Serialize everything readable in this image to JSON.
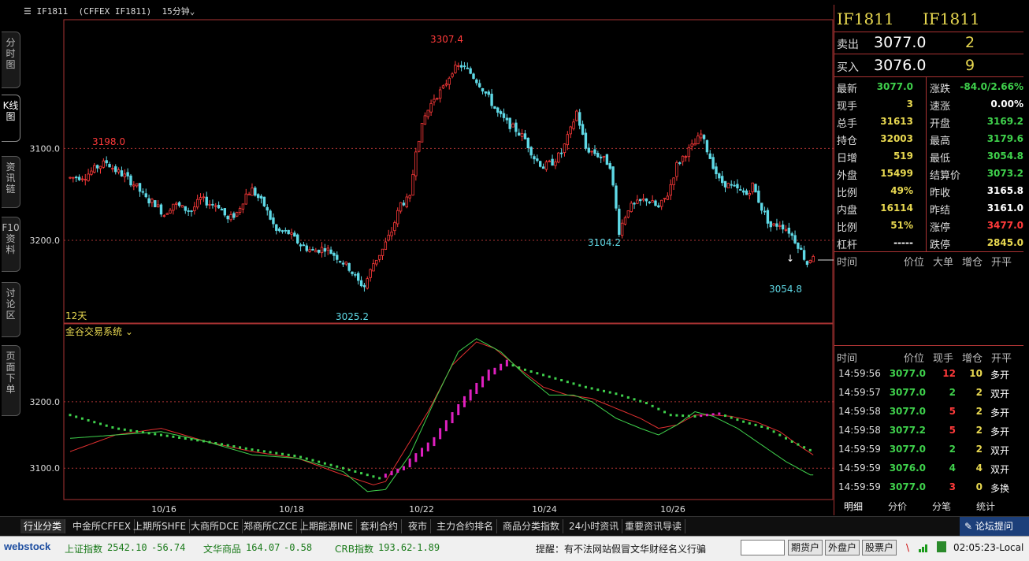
{
  "window": {
    "symbol": "IF1811",
    "exchange_symbol": "(CFFEX IF1811)",
    "period": "15分钟"
  },
  "left_tabs": [
    {
      "label": "分时图",
      "active": false
    },
    {
      "label": "K线图",
      "active": true
    },
    {
      "label": "资讯链",
      "active": false
    },
    {
      "label": "F10资料",
      "active": false
    },
    {
      "label": "讨论区",
      "active": false
    },
    {
      "label": "页面下单",
      "active": false
    }
  ],
  "main_chart": {
    "y_labels": [
      "3200.0",
      "3100.0"
    ],
    "annotations": {
      "high": "3307.4",
      "left_high": "3198.0",
      "low": "3025.2",
      "mid_low": "3104.2",
      "last_low": "3054.8"
    },
    "days_label": "12天"
  },
  "indicator": {
    "name": "金谷交易系统",
    "y_labels": [
      "3200.0",
      "3100.0"
    ]
  },
  "x_dates": [
    "10/16",
    "10/18",
    "10/22",
    "10/24",
    "10/26"
  ],
  "chart_data": {
    "type": "candlestick",
    "ylim": [
      3010,
      3340
    ],
    "y_ticks": [
      3100,
      3200
    ],
    "anchors": [
      [
        0,
        3168
      ],
      [
        5,
        3170
      ],
      [
        9,
        3180
      ],
      [
        12,
        3185
      ],
      [
        15,
        3176
      ],
      [
        18,
        3170
      ],
      [
        22,
        3158
      ],
      [
        25,
        3145
      ],
      [
        28,
        3140
      ],
      [
        31,
        3128
      ],
      [
        34,
        3140
      ],
      [
        37,
        3135
      ],
      [
        40,
        3132
      ],
      [
        43,
        3145
      ],
      [
        46,
        3140
      ],
      [
        49,
        3138
      ],
      [
        52,
        3122
      ],
      [
        55,
        3130
      ],
      [
        58,
        3150
      ],
      [
        60,
        3155
      ],
      [
        64,
        3138
      ],
      [
        68,
        3110
      ],
      [
        72,
        3108
      ],
      [
        76,
        3095
      ],
      [
        80,
        3088
      ],
      [
        84,
        3092
      ],
      [
        88,
        3082
      ],
      [
        92,
        3070
      ],
      [
        95,
        3055
      ],
      [
        97,
        3050
      ],
      [
        100,
        3075
      ],
      [
        103,
        3090
      ],
      [
        106,
        3110
      ],
      [
        109,
        3140
      ],
      [
        112,
        3145
      ],
      [
        114,
        3200
      ],
      [
        117,
        3235
      ],
      [
        120,
        3255
      ],
      [
        123,
        3265
      ],
      [
        126,
        3285
      ],
      [
        129,
        3290
      ],
      [
        132,
        3282
      ],
      [
        135,
        3270
      ],
      [
        138,
        3255
      ],
      [
        141,
        3238
      ],
      [
        144,
        3228
      ],
      [
        147,
        3220
      ],
      [
        150,
        3210
      ],
      [
        153,
        3190
      ],
      [
        156,
        3180
      ],
      [
        159,
        3185
      ],
      [
        162,
        3195
      ],
      [
        165,
        3220
      ],
      [
        167,
        3240
      ],
      [
        170,
        3200
      ],
      [
        173,
        3195
      ],
      [
        176,
        3188
      ],
      [
        178,
        3182
      ],
      [
        181,
        3110
      ],
      [
        184,
        3135
      ],
      [
        187,
        3140
      ],
      [
        190,
        3145
      ],
      [
        194,
        3135
      ],
      [
        197,
        3150
      ],
      [
        200,
        3182
      ],
      [
        203,
        3195
      ],
      [
        206,
        3205
      ],
      [
        208,
        3215
      ],
      [
        211,
        3190
      ],
      [
        214,
        3165
      ],
      [
        217,
        3160
      ],
      [
        220,
        3155
      ],
      [
        223,
        3150
      ],
      [
        225,
        3160
      ],
      [
        228,
        3135
      ],
      [
        231,
        3115
      ],
      [
        234,
        3118
      ],
      [
        237,
        3110
      ],
      [
        240,
        3095
      ],
      [
        243,
        3075
      ],
      [
        245,
        3085
      ]
    ],
    "n": 246,
    "red_line": [
      [
        0,
        3125
      ],
      [
        15,
        3150
      ],
      [
        30,
        3160
      ],
      [
        45,
        3140
      ],
      [
        60,
        3125
      ],
      [
        75,
        3115
      ],
      [
        90,
        3090
      ],
      [
        100,
        3075
      ],
      [
        104,
        3080
      ],
      [
        110,
        3125
      ],
      [
        118,
        3185
      ],
      [
        126,
        3255
      ],
      [
        134,
        3290
      ],
      [
        140,
        3280
      ],
      [
        148,
        3250
      ],
      [
        156,
        3222
      ],
      [
        164,
        3210
      ],
      [
        172,
        3205
      ],
      [
        180,
        3190
      ],
      [
        188,
        3175
      ],
      [
        194,
        3160
      ],
      [
        200,
        3165
      ],
      [
        206,
        3180
      ],
      [
        212,
        3180
      ],
      [
        218,
        3178
      ],
      [
        226,
        3170
      ],
      [
        234,
        3155
      ],
      [
        240,
        3135
      ],
      [
        245,
        3120
      ]
    ],
    "green_line": [
      [
        0,
        3145
      ],
      [
        15,
        3150
      ],
      [
        30,
        3155
      ],
      [
        45,
        3140
      ],
      [
        60,
        3120
      ],
      [
        75,
        3115
      ],
      [
        90,
        3095
      ],
      [
        98,
        3065
      ],
      [
        104,
        3068
      ],
      [
        112,
        3120
      ],
      [
        120,
        3200
      ],
      [
        128,
        3275
      ],
      [
        134,
        3295
      ],
      [
        142,
        3275
      ],
      [
        150,
        3240
      ],
      [
        158,
        3210
      ],
      [
        166,
        3210
      ],
      [
        172,
        3200
      ],
      [
        180,
        3175
      ],
      [
        188,
        3160
      ],
      [
        194,
        3150
      ],
      [
        200,
        3165
      ],
      [
        206,
        3185
      ],
      [
        212,
        3178
      ],
      [
        220,
        3160
      ],
      [
        228,
        3135
      ],
      [
        236,
        3110
      ],
      [
        244,
        3090
      ]
    ],
    "signal_line": [
      [
        0,
        3180
      ],
      [
        15,
        3160
      ],
      [
        30,
        3150
      ],
      [
        45,
        3140
      ],
      [
        60,
        3128
      ],
      [
        75,
        3118
      ],
      [
        90,
        3100
      ],
      [
        102,
        3085
      ],
      [
        110,
        3100
      ],
      [
        120,
        3140
      ],
      [
        130,
        3200
      ],
      [
        138,
        3240
      ],
      [
        144,
        3258
      ],
      [
        150,
        3248
      ],
      [
        160,
        3235
      ],
      [
        170,
        3222
      ],
      [
        180,
        3212
      ],
      [
        190,
        3198
      ],
      [
        198,
        3180
      ],
      [
        206,
        3178
      ],
      [
        214,
        3182
      ],
      [
        222,
        3170
      ],
      [
        230,
        3160
      ],
      [
        238,
        3140
      ],
      [
        245,
        3125
      ]
    ]
  },
  "quote": {
    "title_left": "IF1811",
    "title_right": "IF1811",
    "sell": {
      "label": "卖出",
      "price": "3077.0",
      "qty": "2"
    },
    "buy": {
      "label": "买入",
      "price": "3076.0",
      "qty": "9"
    },
    "rows": [
      {
        "l1": "最新",
        "v1": "3077.0",
        "c1": "g",
        "l2": "涨跌",
        "v2": "-84.0/2.66%",
        "c2": "g"
      },
      {
        "l1": "现手",
        "v1": "3",
        "c1": "y",
        "l2": "速涨",
        "v2": "0.00%",
        "c2": "w"
      },
      {
        "l1": "总手",
        "v1": "31613",
        "c1": "y",
        "l2": "开盘",
        "v2": "3169.2",
        "c2": "g"
      },
      {
        "l1": "持仓",
        "v1": "32003",
        "c1": "y",
        "l2": "最高",
        "v2": "3179.6",
        "c2": "g"
      },
      {
        "l1": "日增",
        "v1": "519",
        "c1": "y",
        "l2": "最低",
        "v2": "3054.8",
        "c2": "g"
      },
      {
        "l1": "外盘",
        "v1": "15499",
        "c1": "y",
        "l2": "结算价",
        "v2": "3073.2",
        "c2": "g"
      },
      {
        "l1": "比例",
        "v1": "49%",
        "c1": "y",
        "l2": "昨收",
        "v2": "3165.8",
        "c2": "w"
      },
      {
        "l1": "内盘",
        "v1": "16114",
        "c1": "y",
        "l2": "昨结",
        "v2": "3161.0",
        "c2": "w"
      },
      {
        "l1": "比例",
        "v1": "51%",
        "c1": "y",
        "l2": "涨停",
        "v2": "3477.0",
        "c2": "r"
      },
      {
        "l1": "杠杆",
        "v1": "-----",
        "c1": "w",
        "l2": "跌停",
        "v2": "2845.0",
        "c2": "y"
      }
    ],
    "tick_header": {
      "time": "时间",
      "price": "价位",
      "bigorder": "大单",
      "oi": "增仓",
      "kp": "开平"
    },
    "trade_header": {
      "time": "时间",
      "price": "价位",
      "qty": "现手",
      "oi": "增仓",
      "kp": "开平"
    },
    "trades": [
      {
        "time": "14:59:56",
        "price": "3077.0",
        "qty": "12",
        "oi": "10",
        "kp": "多开"
      },
      {
        "time": "14:59:57",
        "price": "3077.0",
        "qty": "2",
        "oi": "2",
        "kp": "双开"
      },
      {
        "time": "14:59:58",
        "price": "3077.0",
        "qty": "5",
        "oi": "2",
        "kp": "多开"
      },
      {
        "time": "14:59:58",
        "price": "3077.2",
        "qty": "5",
        "oi": "2",
        "kp": "多开"
      },
      {
        "time": "14:59:59",
        "price": "3077.0",
        "qty": "2",
        "oi": "2",
        "kp": "双开"
      },
      {
        "time": "14:59:59",
        "price": "3076.0",
        "qty": "4",
        "oi": "4",
        "kp": "双开"
      },
      {
        "time": "14:59:59",
        "price": "3077.0",
        "qty": "3",
        "oi": "0",
        "kp": "多换"
      }
    ],
    "subtabs": [
      "明细",
      "分价",
      "分笔",
      "统计"
    ]
  },
  "bottom_tabs": [
    "行业分类",
    "中金所CFFEX",
    "上期所SHFE",
    "大商所DCE",
    "郑商所CZCE",
    "上期能源INE",
    "套利合约",
    "夜市",
    "主力合约排名",
    "商品分类指数",
    "24小时资讯",
    "重要资讯导读"
  ],
  "forum_label": "论坛提问",
  "status": {
    "logo": "webstock",
    "idx1_name": "上证指数",
    "idx1_val": "2542.10",
    "idx1_chg": "-56.74",
    "idx2_name": "文华商品",
    "idx2_val": "164.07",
    "idx2_chg": "-0.58",
    "idx3_name": "CRB指数",
    "idx3_val": "193.62",
    "idx3_chg": "-1.89",
    "notice": "提醒：有不法网站假冒文华财经名义行骗",
    "btn1": "期货户",
    "btn2": "外盘户",
    "btn3": "股票户",
    "time": "02:05:23-Local"
  },
  "colors": {
    "up": "#ff3a3a",
    "down": "#5fd9e6",
    "grid": "#a33",
    "signal": "#e020c0"
  }
}
